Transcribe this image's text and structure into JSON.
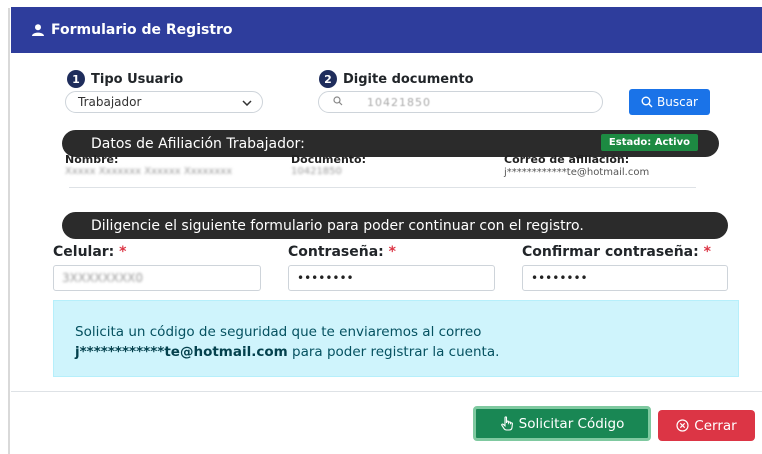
{
  "modal": {
    "title": "Formulario de Registro",
    "title_icon": "user-icon"
  },
  "steps": [
    {
      "number": "1",
      "label": "Tipo Usuario"
    },
    {
      "number": "2",
      "label": "Digite documento"
    }
  ],
  "user_type_select": {
    "selected": "Trabajador",
    "icon": "chevron-down-icon"
  },
  "document_search": {
    "value": "10421850",
    "icon": "search-icon"
  },
  "buscar_button": {
    "label": "Buscar",
    "icon": "search-icon"
  },
  "affiliation": {
    "header": "Datos de Afiliación Trabajador:",
    "status": "Estado: Activo",
    "name_label": "Nombre:",
    "name_value": "Xxxxx Xxxxxxx Xxxxxx Xxxxxxxx",
    "document_label": "Documento:",
    "document_value": "10421850",
    "email_label": "Correo de afiliación:",
    "email_value": "j************te@hotmail.com"
  },
  "form": {
    "instructions": "Diligencie el siguiente formulario para poder continuar con el registro.",
    "celular_label": "Celular:",
    "celular_value": "3XXXXXXXX0",
    "password_label": "Contraseña:",
    "password_value": "••••••••",
    "confirm_label": "Confirmar contraseña:",
    "confirm_value": "••••••••",
    "required_mark": "*"
  },
  "alert": {
    "text_before": "Solicita un código de seguridad que te enviaremos al correo",
    "email": "j************te@hotmail.com",
    "text_after": "para poder registrar la cuenta."
  },
  "footer": {
    "solicitar_label": "Solicitar Código",
    "solicitar_icon": "hand-pointer-icon",
    "cerrar_label": "Cerrar",
    "cerrar_icon": "close-circle-icon"
  },
  "colors": {
    "header": "#2e3d9c",
    "primary": "#1a73e8",
    "success": "#198754",
    "danger": "#dc3545",
    "info_bg": "#cff4fc",
    "dark_bar": "#2b2b2b"
  }
}
